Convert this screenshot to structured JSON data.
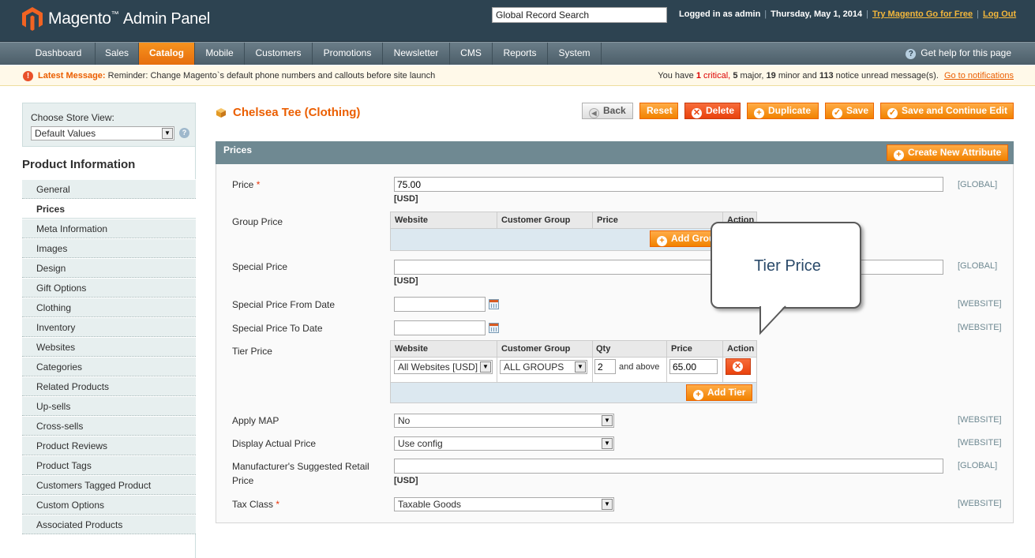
{
  "header": {
    "logo_text": "Magento",
    "logo_tm": "™",
    "logo_suffix": "Admin Panel",
    "search_value": "Global Record Search",
    "logged_in": "Logged in as admin",
    "date": "Thursday, May 1, 2014",
    "try_link": "Try Magento Go for Free",
    "logout": "Log Out",
    "sep": "|"
  },
  "nav": {
    "items": [
      "Dashboard",
      "Sales",
      "Catalog",
      "Mobile",
      "Customers",
      "Promotions",
      "Newsletter",
      "CMS",
      "Reports",
      "System"
    ],
    "active": "Catalog",
    "help": "Get help for this page"
  },
  "message": {
    "label": "Latest Message:",
    "text": "Reminder: Change Magento`s default phone numbers and callouts before site launch",
    "summary_prefix": "You have",
    "critical_count": "1",
    "critical_word": "critical,",
    "major": "5",
    "major_word": "major,",
    "minor": "19",
    "minor_word": "minor and",
    "notice": "113",
    "notice_word": "notice unread message(s).",
    "link": "Go to notifications"
  },
  "sidebar": {
    "store_label": "Choose Store View:",
    "store_value": "Default Values",
    "title": "Product Information",
    "items": [
      "General",
      "Prices",
      "Meta Information",
      "Images",
      "Design",
      "Gift Options",
      "Clothing",
      "Inventory",
      "Websites",
      "Categories",
      "Related Products",
      "Up-sells",
      "Cross-sells",
      "Product Reviews",
      "Product Tags",
      "Customers Tagged Product",
      "Custom Options",
      "Associated Products"
    ],
    "active": "Prices"
  },
  "page": {
    "title": "Chelsea Tee (Clothing)",
    "buttons": {
      "back": "Back",
      "reset": "Reset",
      "delete": "Delete",
      "duplicate": "Duplicate",
      "save": "Save",
      "save_continue": "Save and Continue Edit"
    }
  },
  "prices": {
    "section_title": "Prices",
    "create_attr": "Create New Attribute",
    "price_label": "Price",
    "price_value": "75.00",
    "currency": "[USD]",
    "required": "*",
    "scope_global": "[GLOBAL]",
    "scope_website": "[WEBSITE]",
    "group_price_label": "Group Price",
    "group_cols": [
      "Website",
      "Customer Group",
      "Price",
      "Action"
    ],
    "add_group": "Add Group Price",
    "special_price_label": "Special Price",
    "special_price_value": "",
    "special_from_label": "Special Price From Date",
    "special_to_label": "Special Price To Date",
    "tier_label": "Tier Price",
    "tier_cols": [
      "Website",
      "Customer Group",
      "Qty",
      "Price",
      "Action"
    ],
    "tier_row": {
      "website": "All Websites [USD]",
      "group": "ALL GROUPS",
      "qty": "2",
      "and_above": "and above",
      "price": "65.00"
    },
    "add_tier": "Add Tier",
    "apply_map_label": "Apply MAP",
    "apply_map_value": "No",
    "display_actual_label": "Display Actual Price",
    "display_actual_value": "Use config",
    "msrp_label_1": "Manufacturer's Suggested Retail",
    "msrp_label_2": "Price",
    "tax_class_label": "Tax Class",
    "tax_class_value": "Taxable Goods"
  },
  "callout": {
    "text": "Tier Price"
  },
  "colors": {
    "header_bg": "#2d4351",
    "accent_orange": "#f18200",
    "title_orange": "#eb5e00",
    "section_bg": "#6f8992"
  }
}
